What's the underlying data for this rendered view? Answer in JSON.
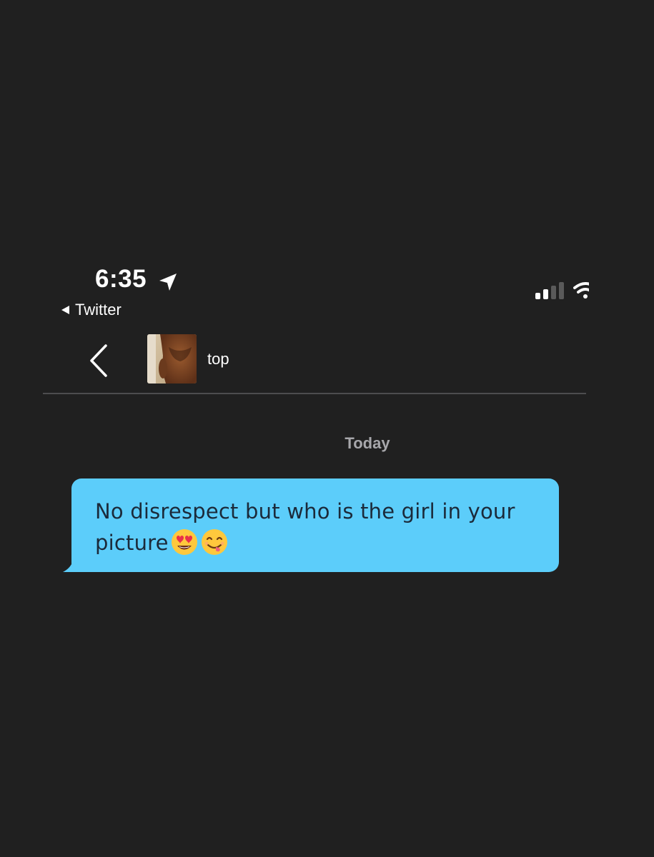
{
  "status_bar": {
    "time": "6:35",
    "back_app_label": "Twitter",
    "location_icon": "location-arrow-icon",
    "signal_icon": "cellular-signal-icon",
    "wifi_icon": "wifi-icon"
  },
  "header": {
    "back_icon": "chevron-left-icon",
    "contact_name": "top"
  },
  "conversation": {
    "date_label": "Today",
    "messages": [
      {
        "text": "No disrespect but who is the girl in your picture",
        "emojis": [
          "heart-eyes-emoji",
          "face-savoring-food-emoji"
        ],
        "bubble_color": "#5ccdfa"
      }
    ]
  },
  "colors": {
    "background": "#202020",
    "divider": "#4d4d4f",
    "bubble": "#5ccdfa",
    "date_label": "#a7a7ab"
  }
}
